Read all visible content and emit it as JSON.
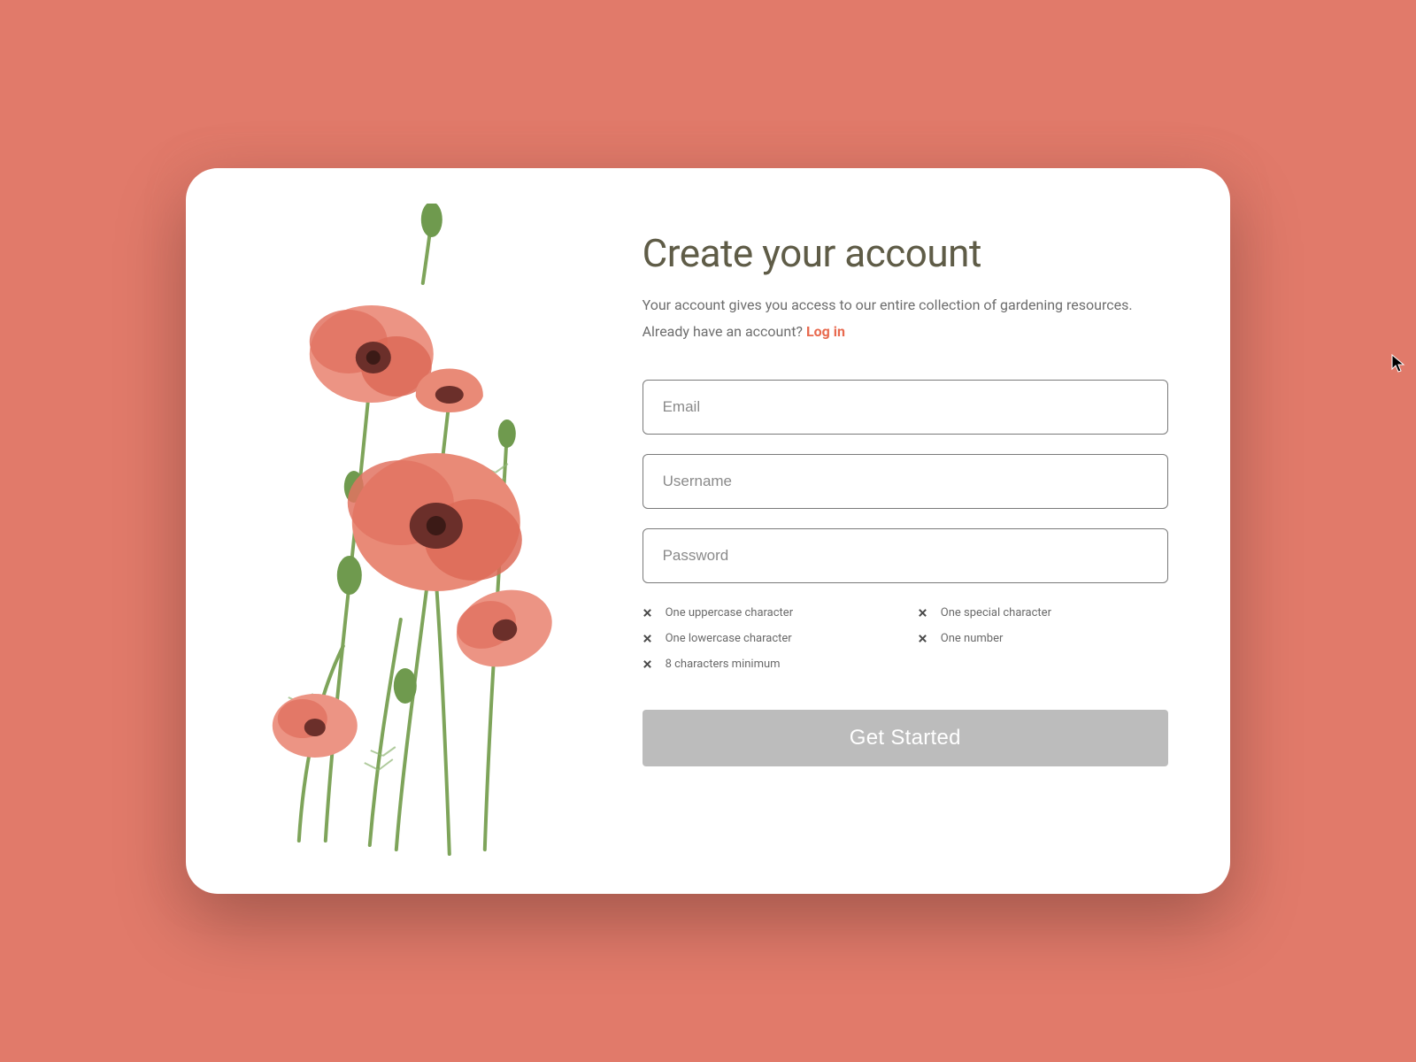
{
  "colors": {
    "background": "#e17a6a",
    "title": "#5f5c47",
    "accent": "#e86a4f",
    "button_disabled": "#bcbcbc"
  },
  "heading": "Create your account",
  "subtitle_prefix": "Your account gives you access to our entire collection of gardening resources. Already have an account? ",
  "login_link_text": "Log in",
  "fields": {
    "email": {
      "placeholder": "Email",
      "value": ""
    },
    "username": {
      "placeholder": "Username",
      "value": ""
    },
    "password": {
      "placeholder": "Password",
      "value": ""
    }
  },
  "password_requirements": [
    {
      "icon": "x-icon",
      "text": "One uppercase character",
      "met": false
    },
    {
      "icon": "x-icon",
      "text": "One special character",
      "met": false
    },
    {
      "icon": "x-icon",
      "text": "One lowercase character",
      "met": false
    },
    {
      "icon": "x-icon",
      "text": "One number",
      "met": false
    },
    {
      "icon": "x-icon",
      "text": "8 characters minimum",
      "met": false
    }
  ],
  "submit_label": "Get Started",
  "submit_enabled": false,
  "illustration": {
    "name": "poppies-watercolor"
  }
}
